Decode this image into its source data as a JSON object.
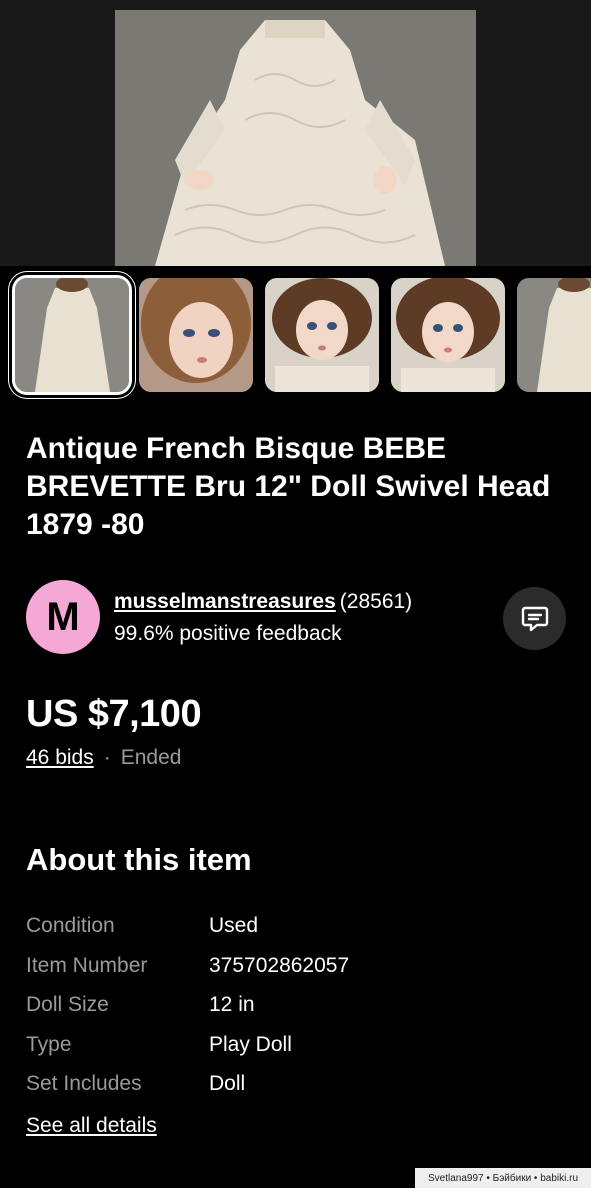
{
  "listing": {
    "title": "Antique French Bisque BEBE BREVETTE Bru 12\"  Doll Swivel Head 1879 -80"
  },
  "gallery": {
    "thumbnail_count": 5,
    "selected_index": 0
  },
  "seller": {
    "avatar_letter": "M",
    "avatar_color": "#f5a8d6",
    "name": "musselmanstreasures",
    "rating_count": "(28561)",
    "feedback": "99.6% positive feedback",
    "contact_icon": "chat-bubble-icon"
  },
  "pricing": {
    "price": "US $7,100",
    "bids": "46 bids",
    "separator": "·",
    "status": "Ended"
  },
  "about": {
    "heading": "About this item",
    "specs": [
      {
        "label": "Condition",
        "value": "Used"
      },
      {
        "label": "Item Number",
        "value": "375702862057"
      },
      {
        "label": "Doll Size",
        "value": "12 in"
      },
      {
        "label": "Type",
        "value": "Play Doll"
      },
      {
        "label": "Set Includes",
        "value": "Doll"
      }
    ],
    "see_all": "See all details"
  },
  "watermark": "Svetlana997 • Бэйбики • babiki.ru"
}
